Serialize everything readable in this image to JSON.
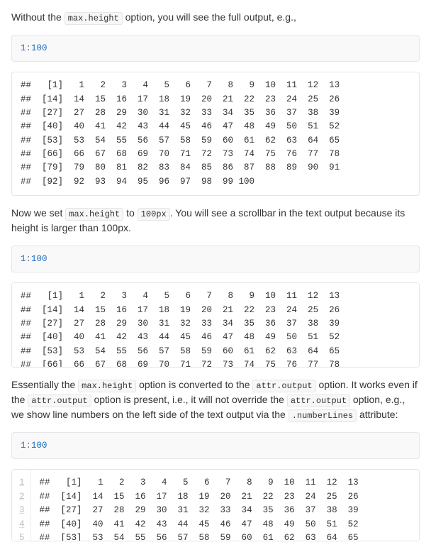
{
  "para1": {
    "before": "Without the ",
    "code": "max.height",
    "after": " option, you will see the full output, e.g.,"
  },
  "code_input": {
    "a": "1",
    "op": ":",
    "b": "100"
  },
  "output_full": "##   [1]   1   2   3   4   5   6   7   8   9  10  11  12  13\n##  [14]  14  15  16  17  18  19  20  21  22  23  24  25  26\n##  [27]  27  28  29  30  31  32  33  34  35  36  37  38  39\n##  [40]  40  41  42  43  44  45  46  47  48  49  50  51  52\n##  [53]  53  54  55  56  57  58  59  60  61  62  63  64  65\n##  [66]  66  67  68  69  70  71  72  73  74  75  76  77  78\n##  [79]  79  80  81  82  83  84  85  86  87  88  89  90  91\n##  [92]  92  93  94  95  96  97  98  99 100",
  "para2": {
    "t1": "Now we set ",
    "c1": "max.height",
    "t2": " to ",
    "c2": "100px",
    "t3": ". You will see a scrollbar in the text output because its height is larger than 100px."
  },
  "para3": {
    "t1": "Essentially the ",
    "c1": "max.height",
    "t2": " option is converted to the ",
    "c2": "attr.output",
    "t3": " option. It works even if the ",
    "c3": "attr.output",
    "t4": " option is present, i.e., it will not override the ",
    "c4": "attr.output",
    "t5": " option, e.g., we show line numbers on the left side of the text output via the ",
    "c5": ".numberLines",
    "t6": " attribute:"
  },
  "numbered_lines": [
    "##   [1]   1   2   3   4   5   6   7   8   9  10  11  12  13",
    "##  [14]  14  15  16  17  18  19  20  21  22  23  24  25  26",
    "##  [27]  27  28  29  30  31  32  33  34  35  36  37  38  39",
    "##  [40]  40  41  42  43  44  45  46  47  48  49  50  51  52",
    "##  [53]  53  54  55  56  57  58  59  60  61  62  63  64  65"
  ]
}
